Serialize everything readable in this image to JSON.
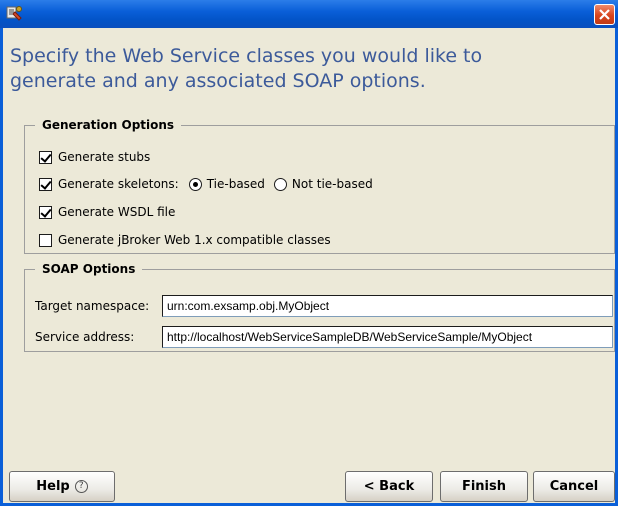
{
  "window": {
    "close_icon": "close-icon",
    "app_icon": "wizard-app-icon",
    "accent": "#0a5fd8",
    "close_color": "#d8451e"
  },
  "heading": {
    "line1": "Specify the Web Service classes you would like to",
    "line2": "generate and any associated SOAP options.",
    "color": "#3c5a9a"
  },
  "generation_options": {
    "legend": "Generation Options",
    "stubs": {
      "label": "Generate stubs",
      "checked": true
    },
    "skeletons": {
      "label": "Generate skeletons:",
      "checked": true
    },
    "tie_based": {
      "label": "Tie-based",
      "selected": true
    },
    "not_tie_based": {
      "label": "Not tie-based",
      "selected": false
    },
    "wsdl": {
      "label": "Generate WSDL file",
      "checked": true
    },
    "jbroker": {
      "label": "Generate jBroker Web 1.x compatible classes",
      "checked": false
    }
  },
  "soap_options": {
    "legend": "SOAP Options",
    "target_namespace": {
      "label": "Target namespace:",
      "value": "urn:com.exsamp.obj.MyObject"
    },
    "service_address": {
      "label": "Service address:",
      "value": "http://localhost/WebServiceSampleDB/WebServiceSample/MyObject"
    }
  },
  "buttons": {
    "help": "Help",
    "back": "< Back",
    "finish": "Finish",
    "cancel": "Cancel"
  }
}
